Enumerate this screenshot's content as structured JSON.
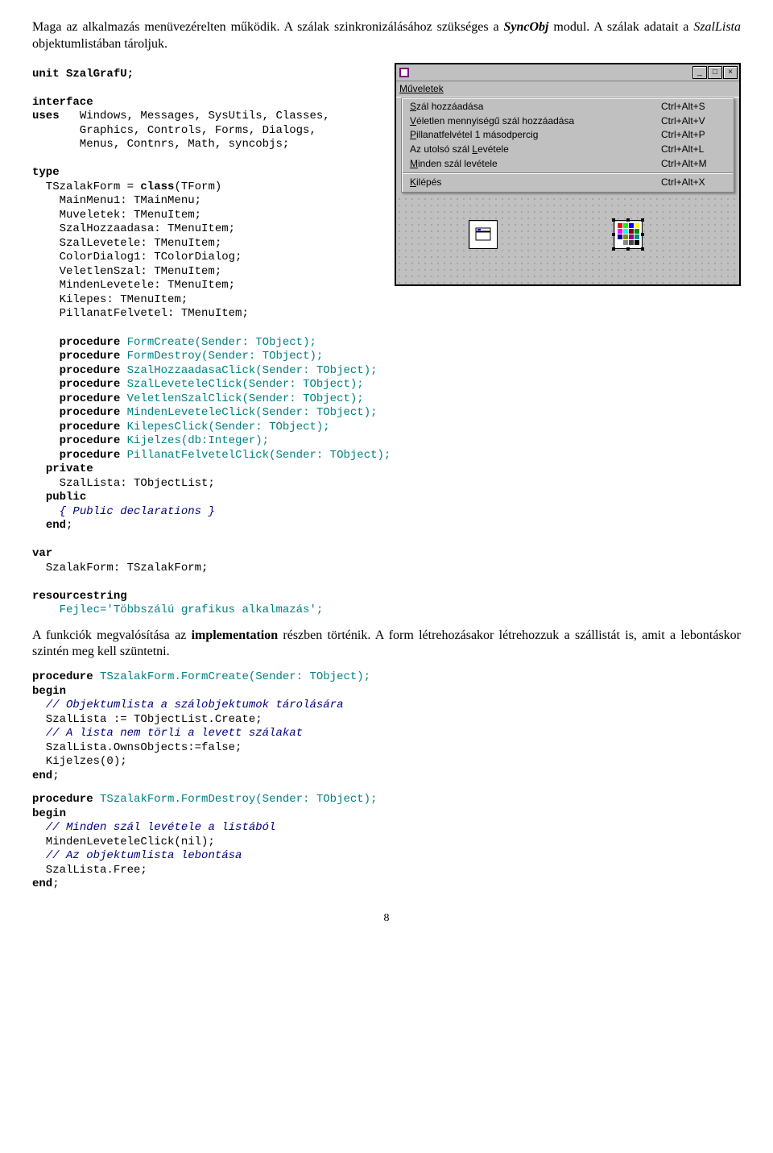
{
  "intro_text_1": "Maga az alkalmazás menüvezérelten működik. A szálak szinkronizálásához szükséges a ",
  "intro_syncobj": "SyncObj",
  "intro_text_2": " modul. A szálak adatait a ",
  "intro_szallista": "SzalLista",
  "intro_text_3": " objektumlistában tároljuk.",
  "menu_window": {
    "menubar": "Műveletek",
    "items": [
      {
        "label": "Szál hozzáadása",
        "underline": "S",
        "shortcut": "Ctrl+Alt+S"
      },
      {
        "label": "Véletlen mennyiségű szál hozzáadása",
        "underline": "V",
        "shortcut": "Ctrl+Alt+V"
      },
      {
        "label": "Pillanatfelvétel 1 másodpercig",
        "underline": "P",
        "shortcut": "Ctrl+Alt+P"
      },
      {
        "label": "Az utolsó szál Levétele",
        "underline": "L",
        "shortcut": "Ctrl+Alt+L"
      },
      {
        "label": "Minden szál levétele",
        "underline": "M",
        "shortcut": "Ctrl+Alt+M"
      },
      {
        "label": "Kilépés",
        "underline": "K",
        "shortcut": "Ctrl+Alt+X"
      }
    ]
  },
  "code1": {
    "l01": "unit SzalGrafU;",
    "l02": "interface",
    "l03a": "uses",
    "l03b": "   Windows, Messages, SysUtils, Classes,",
    "l04": "       Graphics, Controls, Forms, Dialogs,",
    "l05": "       Menus, Contnrs, Math, syncobjs;",
    "l06": "type",
    "l07a": "  TSzalakForm = ",
    "l07b": "class",
    "l07c": "(TForm)",
    "l08": "    MainMenu1: TMainMenu;",
    "l09": "    Muveletek: TMenuItem;",
    "l10": "    SzalHozzaadasa: TMenuItem;",
    "l11": "    SzalLevetele: TMenuItem;",
    "l12": "    ColorDialog1: TColorDialog;",
    "l13": "    VeletlenSzal: TMenuItem;",
    "l14": "    MindenLevetele: TMenuItem;",
    "l15": "    Kilepes: TMenuItem;",
    "l16": "    PillanatFelvetel: TMenuItem;",
    "p01": "FormCreate(Sender: TObject);",
    "p02": "FormDestroy(Sender: TObject);",
    "p03": "SzalHozzaadasaClick(Sender: TObject);",
    "p04": "SzalLeveteleClick(Sender: TObject);",
    "p05": "VeletlenSzalClick(Sender: TObject);",
    "p06": "MindenLeveteleClick(Sender: TObject);",
    "p07": "KilepesClick(Sender: TObject);",
    "p08": "Kijelzes(db:Integer);",
    "p09": "PillanatFelvetelClick(Sender: TObject);",
    "priv": "private",
    "privline": "    SzalLista: TObjectList;",
    "pub": "public",
    "pubcomment": "{ Public declarations }",
    "end": "end",
    "var": "var",
    "varline": "  SzalakForm: TSzalakForm;",
    "rs": "resourcestring",
    "rsline": "    Fejlec='Többszálú grafikus alkalmazás';",
    "procedure": "procedure"
  },
  "mid_text_1": "A funkciók megvalósítása az ",
  "mid_bold": "implementation",
  "mid_text_2": " részben történik. A form létrehozásakor létrehozzuk a szállistát is, amit a lebontáskor szintén meg kell szüntetni.",
  "code2": {
    "sig1": "procedure TSzalakForm.FormCreate(Sender: TObject);",
    "begin": "begin",
    "c1": "// Objektumlista a szálobjektumok tárolására",
    "l1": "  SzalLista := TObjectList.Create;",
    "c2": "// A lista nem törli a levett szálakat",
    "l2": "  SzalLista.OwnsObjects:=false;",
    "l3": "  Kijelzes(0);",
    "end": "end"
  },
  "code3": {
    "sig1": "procedure TSzalakForm.FormDestroy(Sender: TObject);",
    "begin": "begin",
    "c1": "// Minden szál levétele a listából",
    "l1": "  MindenLeveteleClick(nil);",
    "c2": "// Az objektumlista lebontása",
    "l2": "  SzalLista.Free;",
    "end": "end"
  },
  "pagenum": "8"
}
